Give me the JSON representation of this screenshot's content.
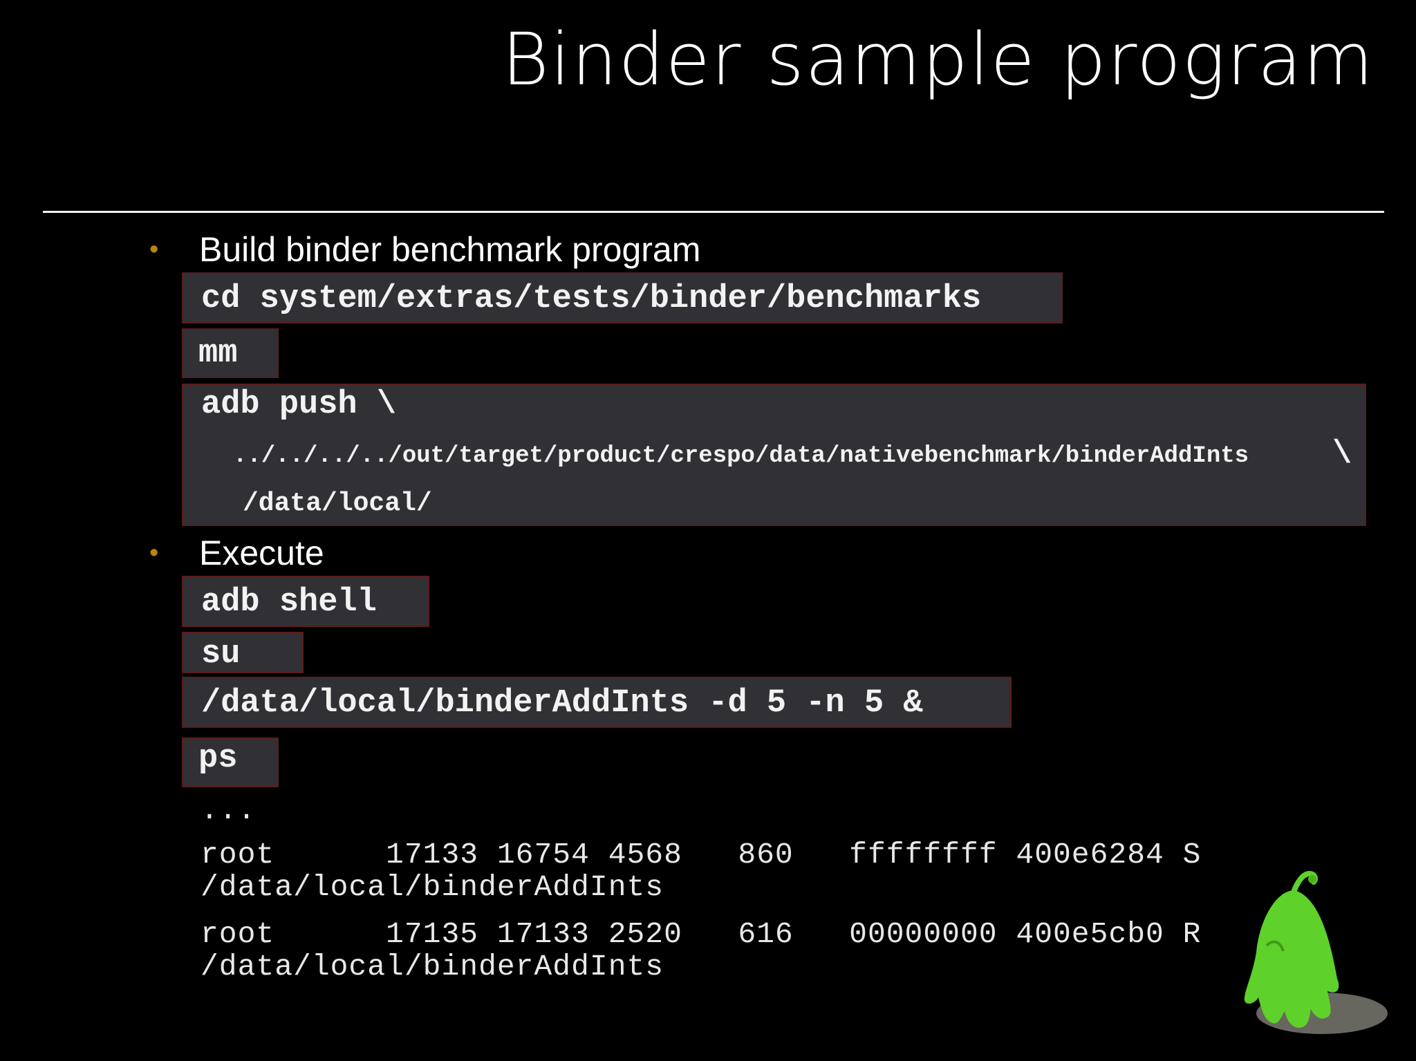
{
  "title": "Binder sample program",
  "sections": [
    {
      "bullet": "•",
      "heading": "Build binder benchmark program",
      "code": [
        "cd system/extras/tests/binder/benchmarks",
        "mm",
        "adb push \\",
        "../../../../out/target/product/crespo/data/nativebenchmark/binderAddInts",
        "\\",
        "/data/local/"
      ]
    },
    {
      "bullet": "•",
      "heading": "Execute",
      "code": [
        "adb shell",
        "su",
        "/data/local/binderAddInts -d 5 -n 5 &",
        "ps"
      ]
    }
  ],
  "ps_output": {
    "ellipsis": "...",
    "rows": [
      {
        "line1": "root      17133 16754 4568   860   ffffffff 400e6284 S",
        "line2": "/data/local/binderAddInts"
      },
      {
        "line1": "root      17135 17133 2520   616   00000000 400e5cb0 R",
        "line2": "/data/local/binderAddInts"
      }
    ]
  },
  "colors": {
    "background": "#000000",
    "code_background": "#303035",
    "code_border": "#5a1d1d",
    "bullet": "#b8860b",
    "mascot": "#5ed12a"
  },
  "icons": {
    "mascot": "green-ghost-mascot-icon"
  }
}
